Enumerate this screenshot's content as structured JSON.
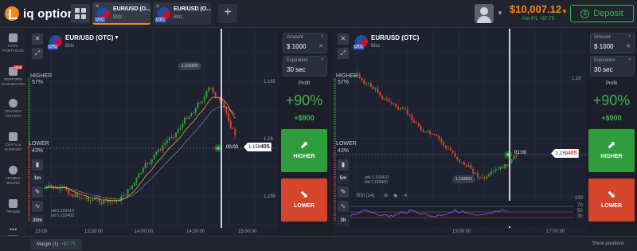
{
  "header": {
    "logo_text": "iq option",
    "tabs": [
      {
        "name": "EUR/USD (O...",
        "sub": "Blitz",
        "otc": "OTC"
      },
      {
        "name": "EUR/USD (O...",
        "sub": "Blitz",
        "otc": "OTC"
      }
    ],
    "add_tab": "+",
    "balance": "$10,007.12",
    "net_pl": "Net P/L +$7.75",
    "deposit_label": "Deposit"
  },
  "sidebar": {
    "items": [
      {
        "label": "Total Portfolio"
      },
      {
        "label": "Perform Dashboard",
        "badge": "NEW"
      },
      {
        "label": "Trading History"
      },
      {
        "label": "Chats & Support"
      },
      {
        "label": "Leader Board"
      },
      {
        "label": "Promo"
      },
      {
        "label": "More"
      }
    ]
  },
  "charts": [
    {
      "asset": "EUR/USD (OTC)",
      "mode": "Blitz",
      "otc": "OTC",
      "higher_label": "HIGHER",
      "higher_pct": "57%",
      "lower_label": "LOWER",
      "lower_pct": "43%",
      "price_label_top": "1.165895",
      "price_axis": [
        "1.165",
        "1.16",
        "1.155"
      ],
      "current_price_main": "1.159",
      "current_price_tail": "405",
      "countdown": "00:00",
      "time_axis": [
        "13:00",
        "13:30:00",
        "14:00:00",
        "14:30:00",
        "15:00:00"
      ],
      "timeframes": [
        "1m",
        "30m"
      ],
      "note_lines": [
        "ask1.159410",
        "bid 1.159400"
      ]
    },
    {
      "asset": "EUR/USD (OTC)",
      "mode": "Blitz",
      "otc": "OTC",
      "higher_label": "HIGHER",
      "higher_pct": "57%",
      "lower_label": "LOWER",
      "lower_pct": "43%",
      "price_axis": [
        "1.18"
      ],
      "low_label": "1.153835",
      "current_price_main": "1.159",
      "current_price_tail": "405",
      "countdown": "01:00",
      "time_axis": [
        "13:00:00",
        "17:00:00"
      ],
      "timeframes": [
        "5m",
        "3h"
      ],
      "note_lines": [
        "ask 1.159410",
        "bid 1.159400"
      ],
      "rsi_label": "RSI (14)",
      "rsi_levels": [
        "100",
        "70",
        "50",
        "30"
      ]
    }
  ],
  "trade_panels": [
    {
      "amount_label": "Amount",
      "amount": "$ 1000",
      "expiration_label": "Expiration",
      "expiration": "30 sec",
      "profit_label": "Profit",
      "profit_pct": "+90%",
      "profit_amount": "+$900",
      "higher_btn": "HIGHER",
      "lower_btn": "LOWER"
    },
    {
      "amount_label": "Amount",
      "amount": "$ 1000",
      "expiration_label": "Expiration",
      "expiration": "30 sec",
      "profit_label": "Profit",
      "profit_pct": "+90%",
      "profit_amount": "+$900",
      "higher_btn": "HIGHER",
      "lower_btn": "LOWER"
    }
  ],
  "bottom": {
    "margin_label": "Margin (1)",
    "margin_value": "+$7.75",
    "show_positions": "Show positions"
  },
  "colors": {
    "accent": "#ff8516",
    "green": "#3fb34f",
    "red": "#d4452c",
    "bg": "#1c1f2a"
  }
}
